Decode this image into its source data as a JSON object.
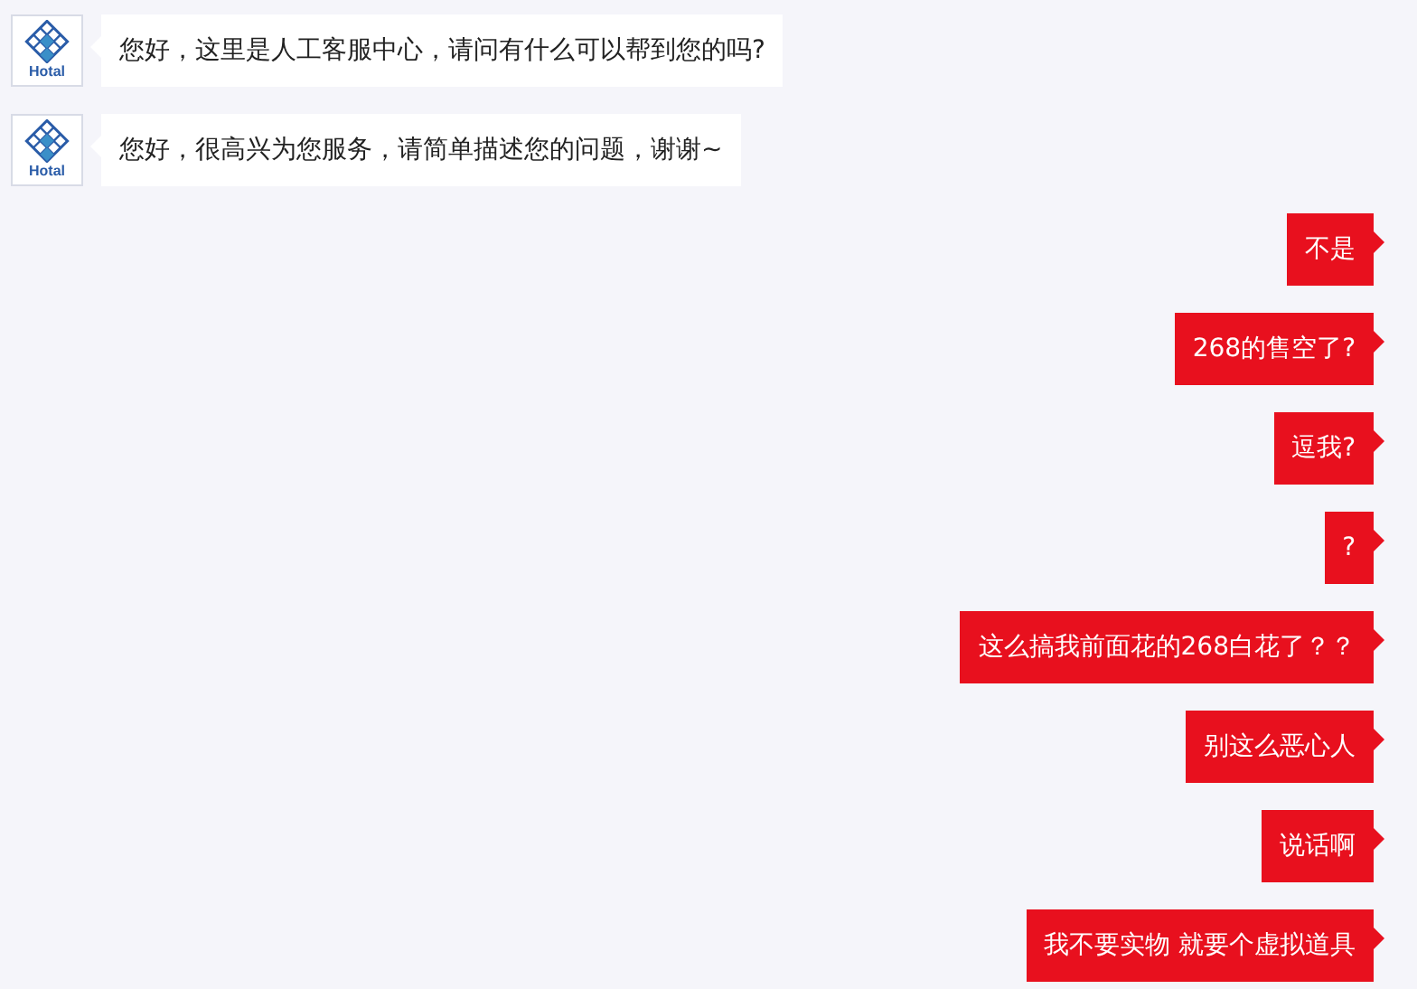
{
  "messages": [
    {
      "kind": "incoming",
      "avatar_label": "Hotal",
      "text": "您好，这里是人工客服中心，请问有什么可以帮到您的吗?"
    },
    {
      "kind": "incoming",
      "avatar_label": "Hotal",
      "text": "您好，很高兴为您服务，请简单描述您的问题，谢谢~"
    },
    {
      "kind": "outgoing",
      "text": "不是"
    },
    {
      "kind": "outgoing",
      "text": "268的售空了?"
    },
    {
      "kind": "outgoing",
      "text": "逗我?"
    },
    {
      "kind": "outgoing",
      "text": "?"
    },
    {
      "kind": "outgoing",
      "text": "这么搞我前面花的268白花了？？"
    },
    {
      "kind": "outgoing",
      "text": "别这么恶心人"
    },
    {
      "kind": "outgoing",
      "text": "说话啊"
    },
    {
      "kind": "outgoing",
      "text": "我不要实物 就要个虚拟道具"
    }
  ]
}
